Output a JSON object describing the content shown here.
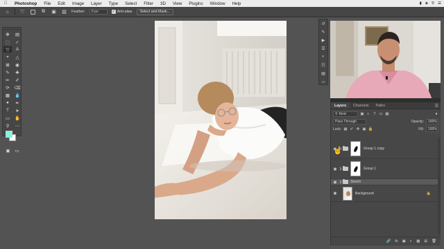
{
  "menubar": {
    "app_name": "Photoshop",
    "items": [
      "File",
      "Edit",
      "Image",
      "Layer",
      "Type",
      "Select",
      "Filter",
      "3D",
      "View",
      "Plugins",
      "Window",
      "Help"
    ]
  },
  "options_bar": {
    "feather_label": "Feather:",
    "feather_value": "0 px",
    "anti_alias_label": "Anti-alias",
    "select_mask_label": "Select and Mask..."
  },
  "colors": {
    "foreground": "#7ff5e4",
    "background": "#ffffff"
  },
  "layers_panel": {
    "tabs": [
      "Layers",
      "Channels",
      "Paths"
    ],
    "active_tab": "Layers",
    "filter_kind": "Kind",
    "blend_mode": "Pass Through",
    "opacity_label": "Opacity:",
    "opacity_value": "100%",
    "lock_label": "Lock:",
    "fill_label": "Fill:",
    "fill_value": "100%",
    "layers": [
      {
        "name": "Group 1 copy",
        "type": "group",
        "visible": true
      },
      {
        "name": "Group 1",
        "type": "group",
        "visible": true
      },
      {
        "name": "Sketch",
        "type": "group",
        "visible": true,
        "selected": true
      },
      {
        "name": "Background",
        "type": "image",
        "visible": true,
        "locked": true
      }
    ]
  },
  "icons": {
    "tools": [
      "move-icon",
      "marquee-icon",
      "lasso-icon",
      "quick-select-icon",
      "crop-icon",
      "frame-icon",
      "eyedropper-icon",
      "healing-icon",
      "brush-icon",
      "stamp-icon",
      "history-brush-icon",
      "eraser-icon",
      "gradient-icon",
      "blur-icon",
      "dodge-icon",
      "pen-icon",
      "type-icon",
      "path-select-icon",
      "rectangle-icon",
      "hand-icon",
      "zoom-icon",
      "more-icon"
    ],
    "strip": [
      "history-icon",
      "brush-settings-icon",
      "play-icon",
      "properties-icon",
      "adjustments-icon",
      "libraries-icon",
      "layers-icon",
      "comments-icon"
    ]
  }
}
